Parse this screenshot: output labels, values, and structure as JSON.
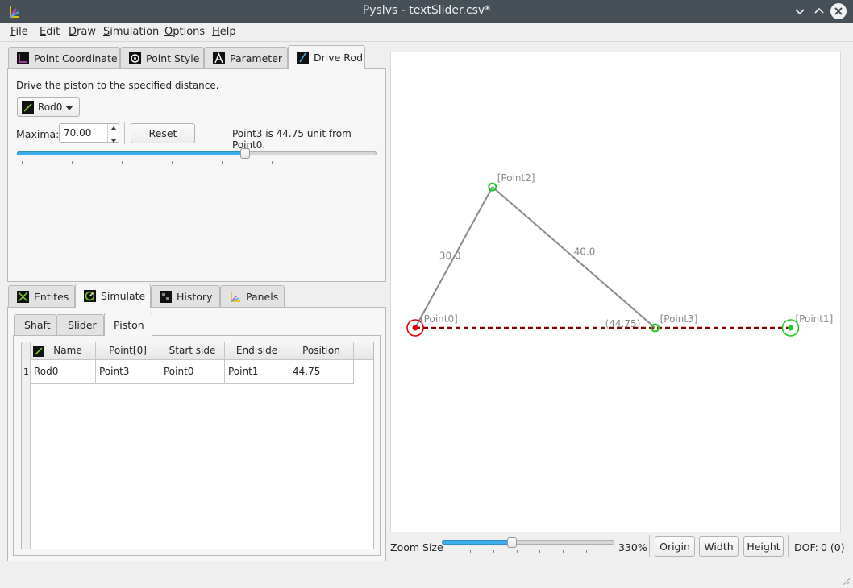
{
  "window": {
    "title": "Pyslvs - textSlider.csv*"
  },
  "menu": [
    "File",
    "Edit",
    "Draw",
    "Simulation",
    "Options",
    "Help"
  ],
  "top_tabs": [
    "Point Coordinate",
    "Point Style",
    "Parameter",
    "Drive Rod"
  ],
  "drive_rod": {
    "description": "Drive the piston to the specified distance.",
    "rod_select": "Rod0",
    "maxima_label": "Maxima:",
    "maxima_value": "70.00",
    "reset_label": "Reset",
    "status": "Point3 is 44.75 unit from Point0.",
    "slider_fraction": 0.639
  },
  "bottom_tabs": [
    "Entites",
    "Simulate",
    "History",
    "Panels"
  ],
  "sim_tabs": [
    "Shaft",
    "Slider",
    "Piston"
  ],
  "piston_table": {
    "headers": [
      "Name",
      "Point[0]",
      "Start side",
      "End side",
      "Position"
    ],
    "rows": [
      {
        "index": "1",
        "cells": [
          "Rod0",
          "Point3",
          "Point0",
          "Point1",
          "44.75"
        ]
      }
    ]
  },
  "canvas": {
    "points": [
      {
        "name": "Point0",
        "label": "[Point0]",
        "x": 0,
        "y": 0,
        "color": "#e00000"
      },
      {
        "name": "Point1",
        "label": "[Point1]",
        "x": 70,
        "y": 0,
        "color": "#22cc22"
      },
      {
        "name": "Point2",
        "label": "[Point2]",
        "x": 14.4,
        "y": 26.3,
        "color": "#22cc22"
      },
      {
        "name": "Point3",
        "label": "[Point3]",
        "x": 44.75,
        "y": 0,
        "color": "#22cc22"
      }
    ],
    "links": [
      {
        "from": "Point0",
        "to": "Point2",
        "label": "30.0"
      },
      {
        "from": "Point2",
        "to": "Point3",
        "label": "40.0"
      }
    ],
    "rod": {
      "from": "Point0",
      "to": "Point1",
      "label": "(44.75)",
      "color": "#8b0000"
    }
  },
  "bottom_bar": {
    "zoom_label": "Zoom Size",
    "zoom_value": "330%",
    "zoom_fraction": 0.4,
    "origin_label": "Origin",
    "width_label": "Width",
    "height_label": "Height",
    "dof_label": "DOF:",
    "dof_value": "0 (0)"
  }
}
